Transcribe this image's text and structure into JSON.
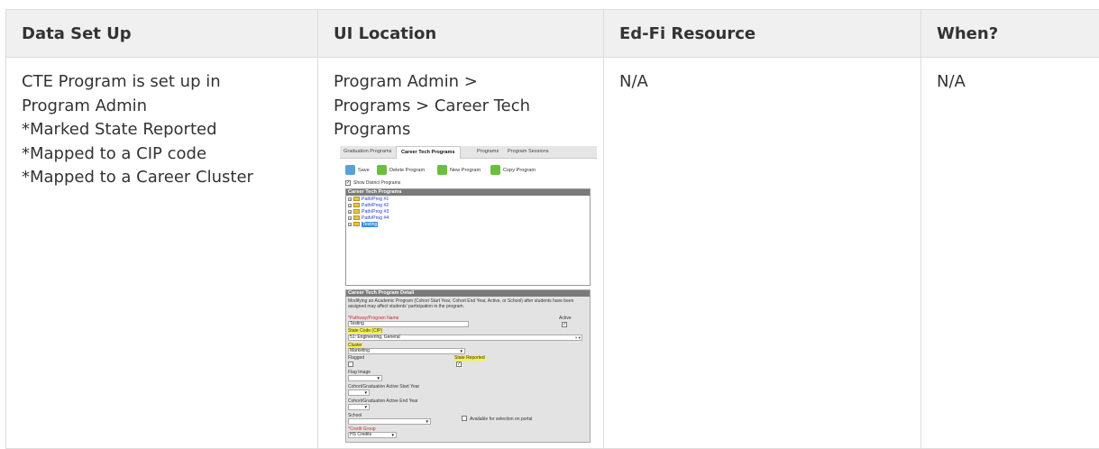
{
  "table": {
    "headers": [
      "Data Set Up",
      "UI Location",
      "Ed-Fi Resource",
      "When?"
    ],
    "row": {
      "data_set_up": [
        "CTE Program is set up in",
        "Program Admin",
        "*Marked State Reported",
        "*Mapped to a CIP code",
        "*Mapped to a Career Cluster"
      ],
      "ui_location": [
        "Program Admin >",
        "Programs > Career Tech",
        "Programs"
      ],
      "edfi_resource": "N/A",
      "when": "N/A"
    }
  },
  "screenshot": {
    "tabs": [
      "Graduation Programs",
      "Career Tech Programs",
      "Programs",
      "Program Sessions"
    ],
    "active_tab": "Career Tech Programs",
    "toolbar": {
      "save": "Save",
      "delete": "Delete Program",
      "new": "New Program",
      "copy": "Copy Program"
    },
    "show_district": "Show District Programs",
    "tree_header": "Career Tech Programs",
    "tree_items": [
      "Path/Prog #1",
      "Path/Prog #2",
      "Path/Prog #3",
      "Path/Prog #4",
      "Testing"
    ],
    "detail": {
      "header": "Career Tech Program Detail",
      "warning": "Modifying an Academic Program (Cohort Start Year, Cohort End Year, Active, or School) after students have been assigned may affect students' participation in the program.",
      "name_label": "*Pathway/Program Name",
      "name_value": "Testing",
      "active_label": "Active",
      "cip_label": "State Code (CIP)",
      "cip_value": "51: Engineering, General",
      "cluster_label": "Cluster",
      "cluster_value": "Marketing",
      "flagged_label": "Flagged",
      "state_reported_label": "State Reported",
      "flag_image_label": "Flag Image",
      "start_year_label": "Cohort/Graduation Active Start Year",
      "end_year_label": "Cohort/Graduation Active End Year",
      "school_label": "School",
      "portal_label": "Available for selection on portal",
      "credit_group_label": "*Credit Group",
      "credit_group_value": "HS Credits"
    }
  }
}
